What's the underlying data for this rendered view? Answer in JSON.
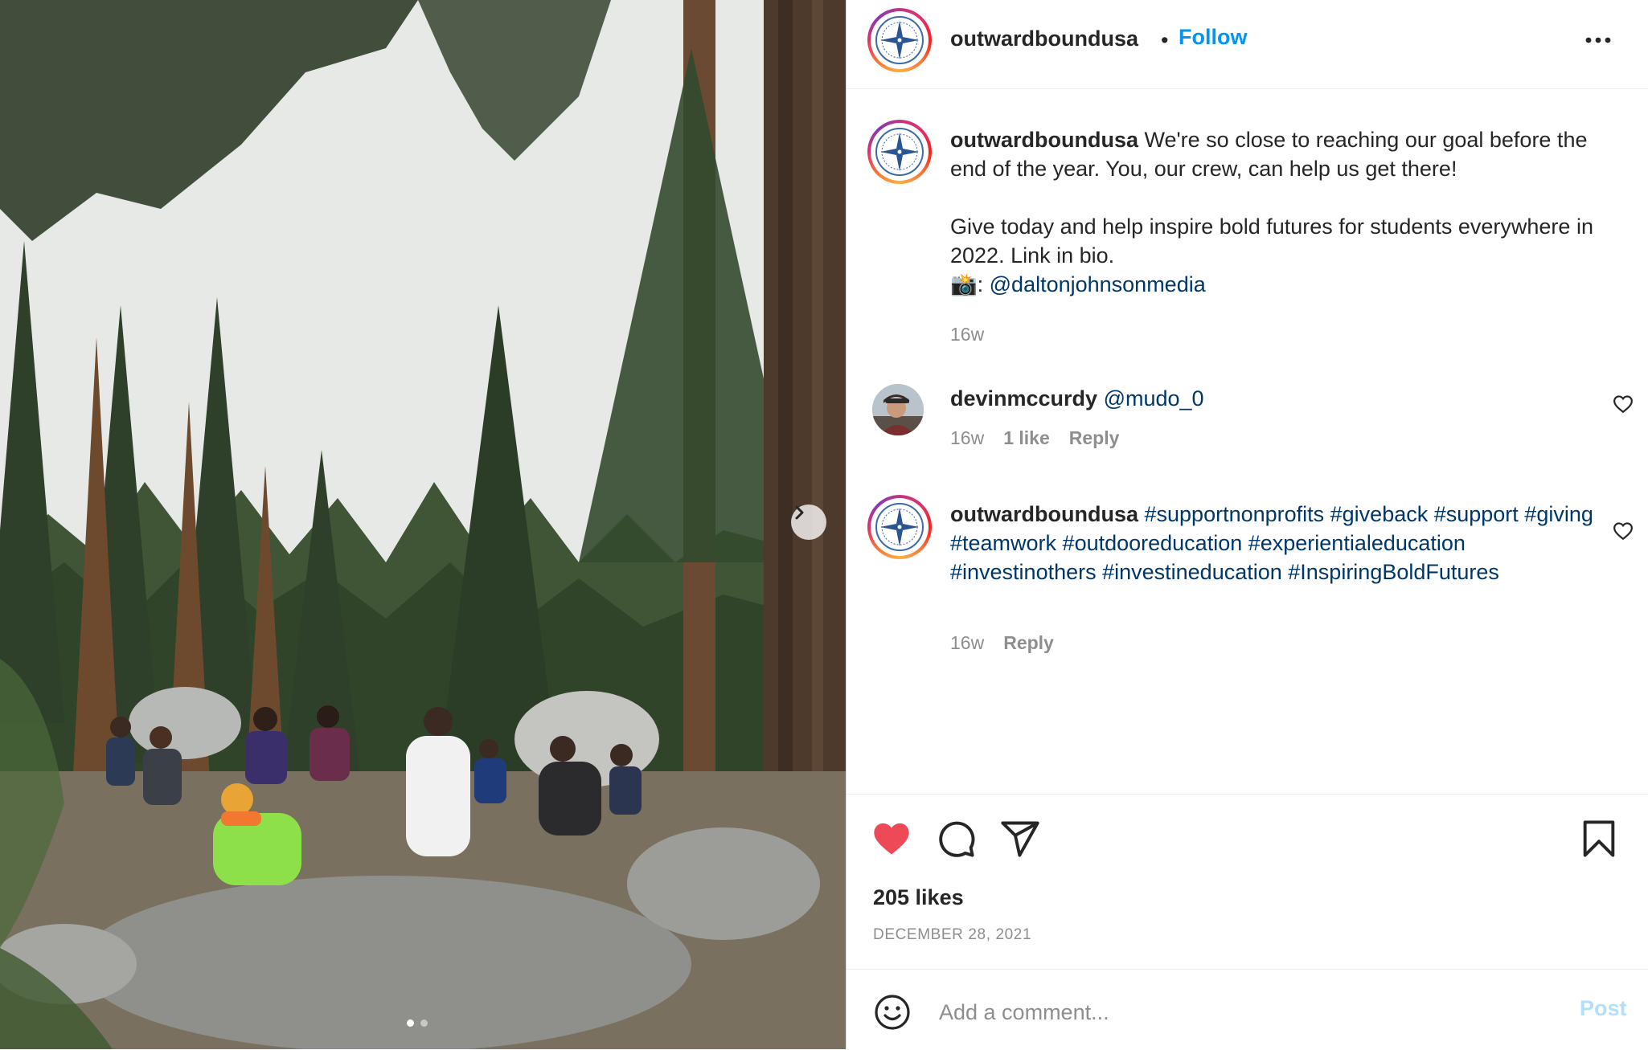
{
  "header": {
    "username": "outwardboundusa",
    "separator": "•",
    "follow_label": "Follow",
    "more_icon": "more-horizontal-icon"
  },
  "caption": {
    "username": "outwardboundusa",
    "text_part1": "We're so close to reaching our goal before the end of the year. You, our crew, can help us get there!\n\nGive today and help inspire bold futures for students everywhere in 2022. Link in bio.\n",
    "camera_emoji": "📸",
    "camera_suffix": ": ",
    "mention": "@daltonjohnsonmedia",
    "time": "16w"
  },
  "comments": [
    {
      "username": "devinmccurdy",
      "mention": "@mudo_0",
      "time": "16w",
      "likes": "1 like",
      "reply_label": "Reply"
    },
    {
      "username": "outwardboundusa",
      "hashtags": "#supportnonprofits #giveback #support #giving #teamwork #outdooreducation #experientialeducation #investinothers #investineducation #InspiringBoldFutures",
      "time": "16w",
      "reply_label": "Reply"
    }
  ],
  "actions": {
    "like_icon": "heart-filled-icon",
    "comment_icon": "comment-icon",
    "share_icon": "share-icon",
    "save_icon": "bookmark-icon",
    "likes_text": "205 likes",
    "date_text": "DECEMBER 28, 2021"
  },
  "composer": {
    "emoji_icon": "smiley-icon",
    "placeholder": "Add a comment...",
    "post_label": "Post"
  },
  "carousel": {
    "total_slides": 2,
    "active_slide": 1
  },
  "colors": {
    "accent": "#0095f6",
    "link": "#00376b",
    "like_red": "#ed4956",
    "muted": "#8e8e8e",
    "post_disabled": "#b2dffc"
  }
}
